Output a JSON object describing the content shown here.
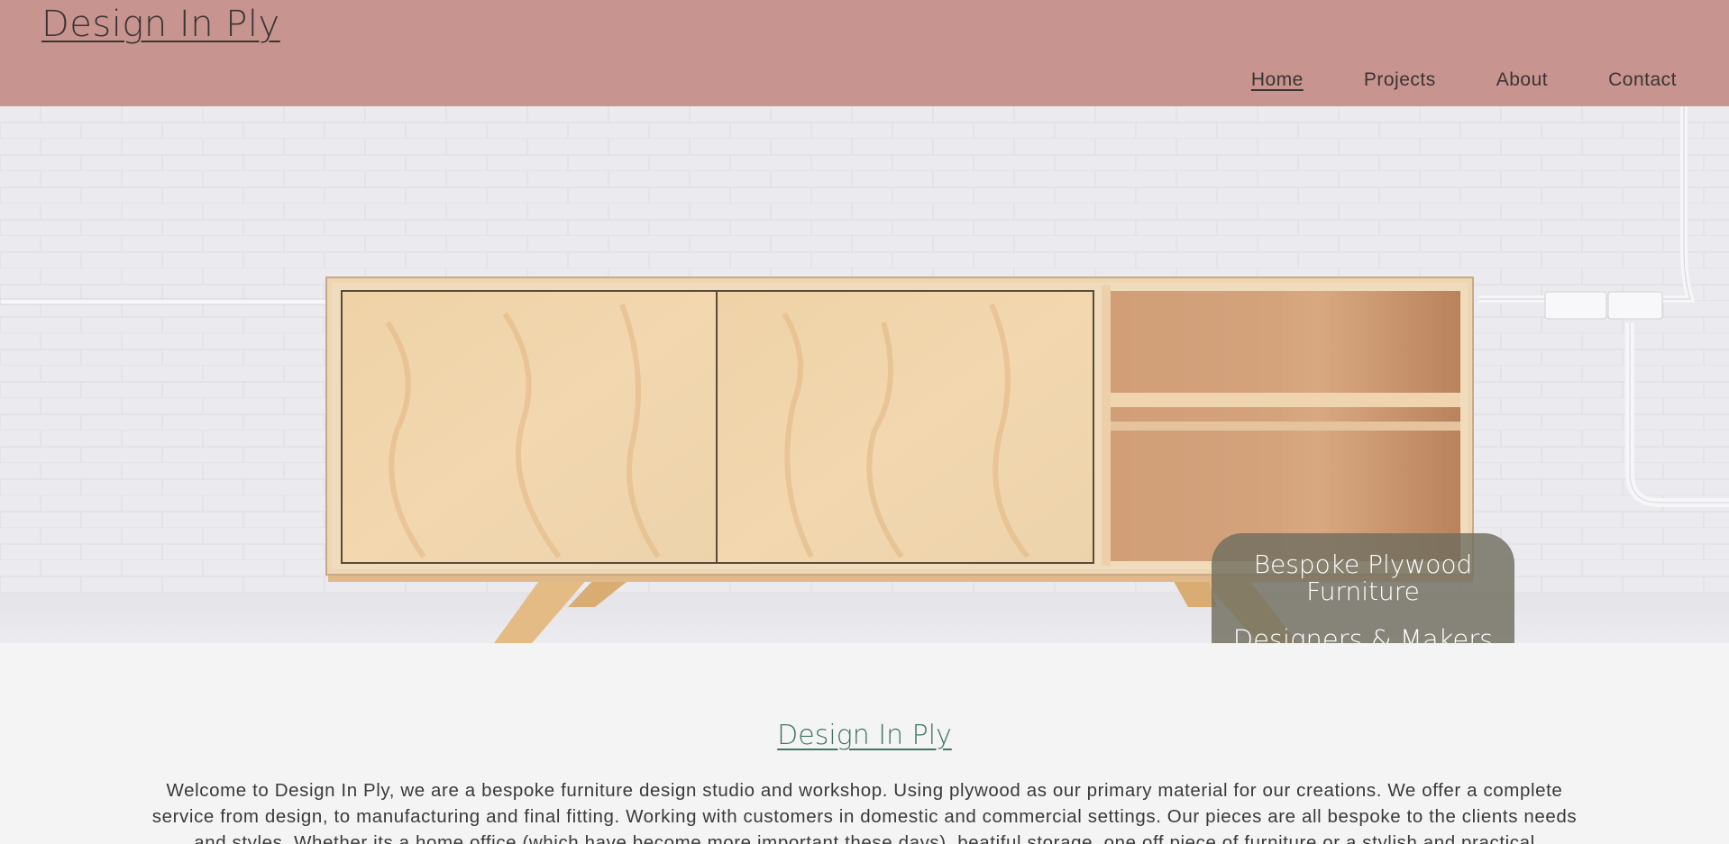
{
  "header": {
    "site_title": "Design In Ply",
    "nav": [
      {
        "label": "Home",
        "active": true
      },
      {
        "label": "Projects",
        "active": false
      },
      {
        "label": "About",
        "active": false
      },
      {
        "label": "Contact",
        "active": false
      }
    ]
  },
  "hero": {
    "badge_line1": "Bespoke Plywood Furniture",
    "badge_line2": "Designers & Makers"
  },
  "content": {
    "title": "Design In Ply",
    "intro": "Welcome to Design In Ply, we are a bespoke furniture design studio and workshop. Using plywood as our primary material for our creations. We offer a complete service from design, to manufacturing and final fitting. Working with customers in domestic and commercial settings. Our pieces are all bespoke to the clients needs and styles. Whether its a home office (which have become more important these days), beatiful storage, one off piece of furniture or a stylish and practical"
  },
  "colors": {
    "header_bg": "#c7948f",
    "accent_green": "#3f7764",
    "page_bg": "#f4f4f4",
    "badge_bg": "#706e5f"
  }
}
